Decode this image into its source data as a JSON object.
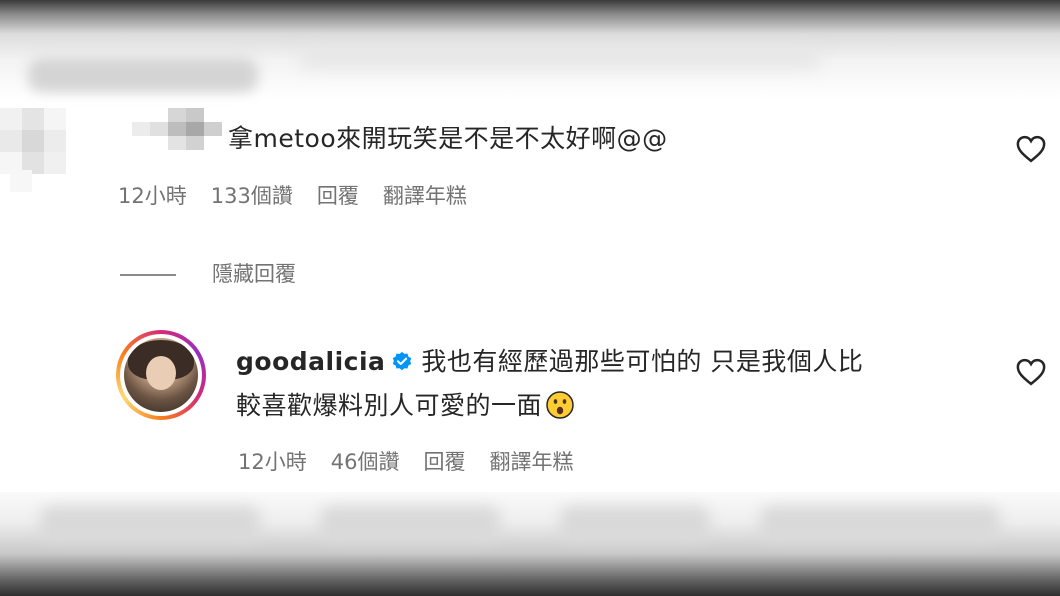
{
  "comment_1": {
    "text": "拿metoo來開玩笑是不是不太好啊@@",
    "time": "12小時",
    "likes": "133個讚",
    "reply_label": "回覆",
    "translate_label": "翻譯年糕"
  },
  "hide_replies_label": "隱藏回覆",
  "comment_2": {
    "username": "goodalicia",
    "text_line1": "我也有經歷過那些可怕的 只是我個人比",
    "text_line2": "較喜歡爆料別人可愛的一面",
    "emoji": "hushed-face-emoji",
    "time": "12小時",
    "likes": "46個讚",
    "reply_label": "回覆",
    "translate_label": "翻譯年糕"
  },
  "colors": {
    "text": "#262626",
    "meta": "#737373",
    "verified": "#0095f6",
    "ring_start": "#d62976",
    "ring_end": "#feda75"
  },
  "icons": [
    "heart-icon",
    "verified-badge-icon",
    "hushed-face-emoji"
  ]
}
